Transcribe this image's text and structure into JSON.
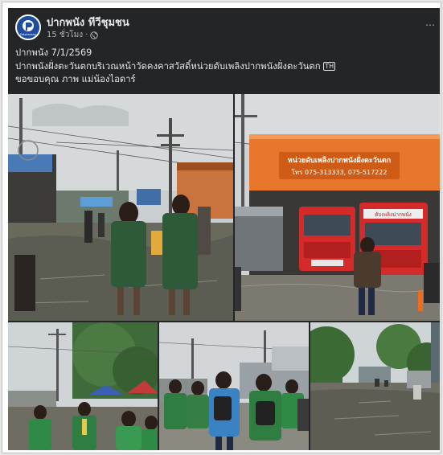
{
  "post": {
    "page_name": "ปากพนัง ทีวีชุมชน",
    "time": "15 ชั่วโมง",
    "privacy_icon": "globe-icon",
    "more_icon": "more-options-icon",
    "lines": [
      "ปากพนัง 7/1/2569",
      "ปากพนังฝั่งตะวันตกบริเวณหน้าวัดคงคาสวัสดิ์หน่วยดับเพลิงปากพนังฝั่งตะวันตก",
      "ขอขอบคุณ ภาพ แม่น้องไอดาร์"
    ],
    "tag_label": "TH",
    "avatar_text": "Pakphanang"
  },
  "photos": {
    "fire_station_sign_line1": "หน่วยดับเพลิงปากพนังฝั่งตะวันตก",
    "fire_station_sign_line2": "โทร 075-313333, 075-517222",
    "truck_label": "ดับเพลิงปากพนัง"
  },
  "colors": {
    "card_bg": "#242526",
    "text_primary": "#e4e6eb",
    "text_secondary": "#b0b3b8",
    "fire_station_orange": "#e8762c",
    "truck_red": "#d42a2a"
  }
}
